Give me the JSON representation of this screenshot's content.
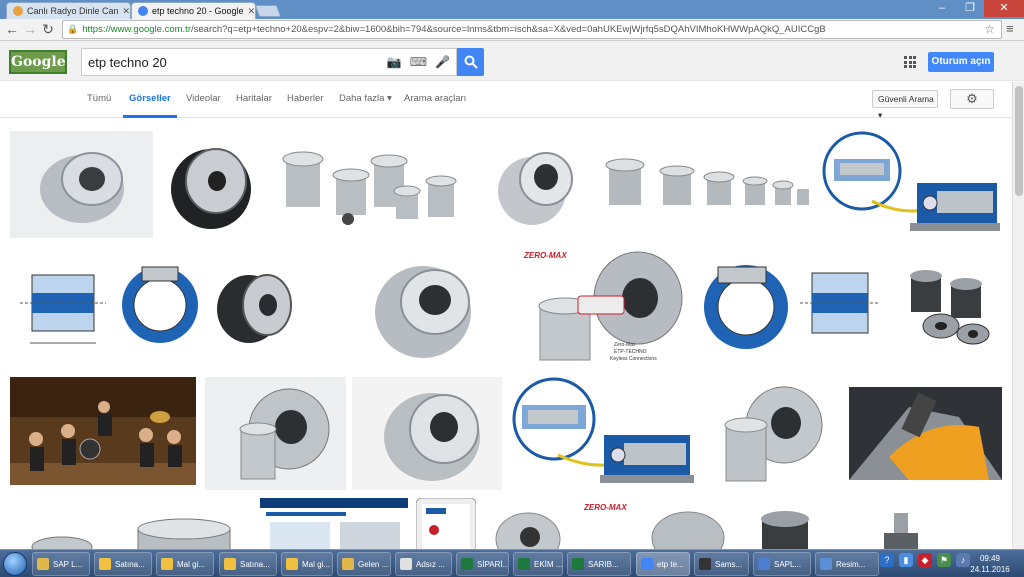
{
  "browser": {
    "tabs": [
      {
        "title": "Canlı Radyo Dinle Can",
        "active": false,
        "fav_color": "#e8a33c"
      },
      {
        "title": "etp techno 20 - Google",
        "active": true,
        "fav_color": "#4285f4"
      }
    ],
    "url_host": "https://www.google.com.tr",
    "url_rest": "/search?q=etp+techno+20&espv=2&biw=1600&bih=794&source=lnms&tbm=isch&sa=X&ved=0ahUKEwjWjrfq5sDQAhVIMhoKHWWpAQkQ_AUICCgB"
  },
  "google": {
    "logo_text": "Google",
    "query": "etp techno 20",
    "signin_label": "Oturum açın",
    "nav_tabs": [
      "Tümü",
      "Görseller",
      "Videolar",
      "Haritalar",
      "Haberler",
      "Daha fazla ▾",
      "Arama araçları"
    ],
    "active_tab": "Görseller",
    "safesearch_label": "Güvenli Arama ▾"
  },
  "taskbar": {
    "items": [
      {
        "label": "SAP L...",
        "color": "#e0b84a"
      },
      {
        "label": "Satına...",
        "color": "#f0c040"
      },
      {
        "label": "Mal gi...",
        "color": "#f0c040"
      },
      {
        "label": "Satına...",
        "color": "#f0c040"
      },
      {
        "label": "Mal gi...",
        "color": "#f0c040"
      },
      {
        "label": "Gelen ...",
        "color": "#e0b84a"
      },
      {
        "label": "Adsız ...",
        "color": "#e0e0e0"
      },
      {
        "label": "SİPARİ...",
        "color": "#1e7a3c"
      },
      {
        "label": "EKİM ...",
        "color": "#1e7a3c"
      },
      {
        "label": "SARIB...",
        "color": "#1e7a3c"
      },
      {
        "label": "etp te...",
        "color": "#4285f4"
      },
      {
        "label": "Sams...",
        "color": "#333333"
      },
      {
        "label": "SAPL...",
        "color": "#4a7fd0"
      },
      {
        "label": "Resim...",
        "color": "#5b8fd8"
      }
    ],
    "time": "09:49",
    "date": "24.11.2016"
  }
}
